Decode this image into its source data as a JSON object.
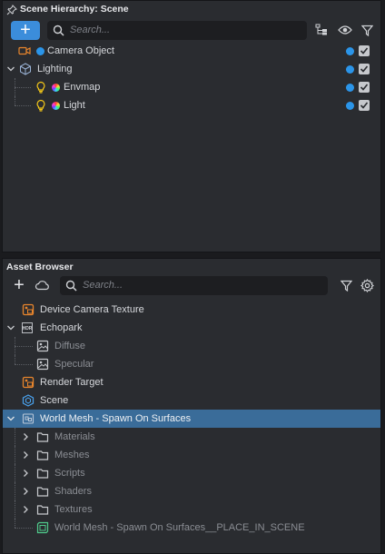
{
  "scene_hierarchy": {
    "title": "Scene Hierarchy: Scene",
    "search_placeholder": "Search...",
    "add_label": "+",
    "items": [
      {
        "label": "Camera Object"
      },
      {
        "label": "Lighting"
      },
      {
        "label": "Envmap"
      },
      {
        "label": "Light"
      }
    ]
  },
  "asset_browser": {
    "title": "Asset Browser",
    "search_placeholder": "Search...",
    "add_label": "+",
    "items": [
      {
        "label": "Device Camera Texture"
      },
      {
        "label": "Echopark"
      },
      {
        "label": "Diffuse"
      },
      {
        "label": "Specular"
      },
      {
        "label": "Render Target"
      },
      {
        "label": "Scene"
      },
      {
        "label": "World Mesh - Spawn On Surfaces"
      },
      {
        "label": "Materials"
      },
      {
        "label": "Meshes"
      },
      {
        "label": "Scripts"
      },
      {
        "label": "Shaders"
      },
      {
        "label": "Textures"
      },
      {
        "label": "World Mesh - Spawn On Surfaces__PLACE_IN_SCENE"
      }
    ]
  },
  "colors": {
    "accent": "#3b8ddb",
    "selection": "#3a6c99",
    "asset_orange": "#e8852c",
    "visibility_dot": "#2b95e9"
  },
  "icons": [
    "pin-icon",
    "search-icon",
    "hierarchy-icon",
    "eye-icon",
    "filter-icon",
    "cloud-icon",
    "gear-icon",
    "camera-icon",
    "lighting-icon",
    "bulb-icon",
    "texture-icon",
    "hdr-icon",
    "image-icon",
    "render-target-icon",
    "scene-icon",
    "mesh-icon",
    "folder-icon",
    "prefab-icon",
    "chevron-down-icon",
    "chevron-right-icon"
  ]
}
